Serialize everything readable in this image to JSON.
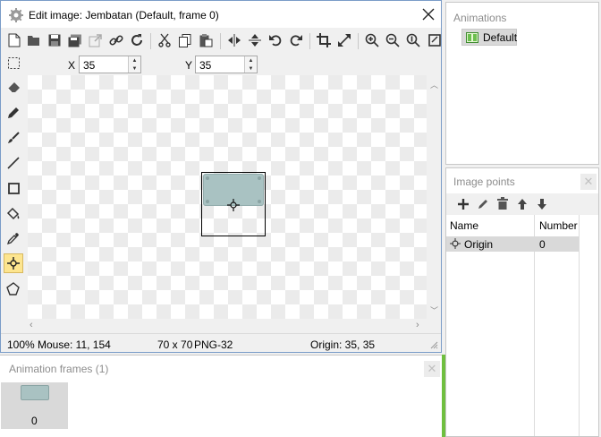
{
  "editor": {
    "title": "Edit image: Jembatan (Default, frame 0)",
    "x_label": "X",
    "x_value": "35",
    "y_label": "Y",
    "y_value": "35",
    "status": {
      "zoom": "100%",
      "mouse": "Mouse: 11, 154",
      "size": "70 x 70",
      "format": "PNG-32",
      "origin": "Origin: 35, 35"
    },
    "toolbar_icons": [
      "new-icon",
      "open-icon",
      "save-icon",
      "save-copy-icon",
      "export-icon",
      "link-icon",
      "refresh-icon",
      "cut-icon",
      "copy-icon",
      "paste-icon",
      "flip-horizontal-icon",
      "flip-vertical-icon",
      "rotate-left-icon",
      "rotate-right-icon",
      "crop-icon",
      "resize-icon",
      "zoom-in-icon",
      "zoom-out-icon",
      "zoom-fit-icon",
      "fullscreen-icon"
    ],
    "side_tools": [
      "select-icon",
      "eraser-icon",
      "pencil-icon",
      "brush-icon",
      "line-icon",
      "rectangle-icon",
      "fill-icon",
      "eyedropper-icon",
      "origin-point-icon",
      "polygon-icon"
    ],
    "active_tool": "origin-point-icon"
  },
  "animations": {
    "title": "Animations",
    "items": [
      {
        "label": "Default",
        "selected": true
      }
    ]
  },
  "image_points": {
    "title": "Image points",
    "columns": [
      "Name",
      "Number"
    ],
    "rows": [
      {
        "name": "Origin",
        "number": "0"
      }
    ]
  },
  "animation_frames": {
    "title": "Animation frames (1)",
    "frames": [
      {
        "label": "0"
      }
    ]
  },
  "colors": {
    "active_tool_bg": "#fde58f",
    "selected_row": "#d9d9d9",
    "sprite_fill": "#a9c2c2",
    "canvas_checker": "#ebebeb"
  }
}
